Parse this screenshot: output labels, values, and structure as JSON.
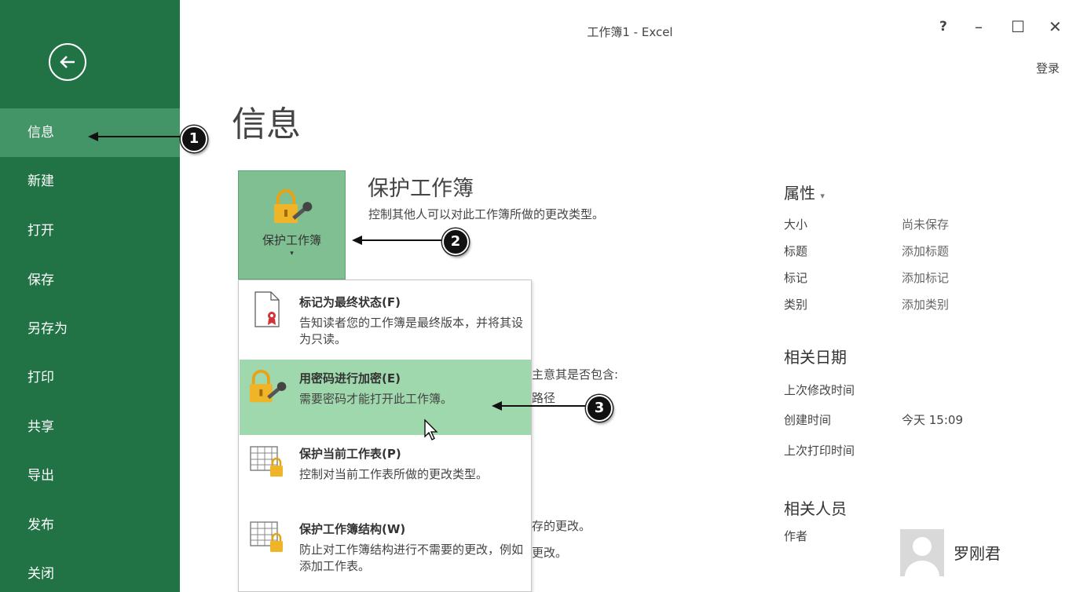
{
  "window": {
    "title": "工作簿1 - Excel",
    "help": "?",
    "minimize": "–",
    "maximize": "☐",
    "close": "✕",
    "login": "登录"
  },
  "sidebar": {
    "back_icon": "back-arrow-circle-icon",
    "items": [
      {
        "label": "信息",
        "active": true
      },
      {
        "label": "新建"
      },
      {
        "label": "打开"
      },
      {
        "label": "保存"
      },
      {
        "label": "另存为"
      },
      {
        "label": "打印"
      },
      {
        "label": "共享"
      },
      {
        "label": "导出"
      },
      {
        "label": "发布"
      },
      {
        "label": "关闭"
      }
    ]
  },
  "main": {
    "title": "信息",
    "protect": {
      "button_label": "保护工作簿",
      "caret": "▾",
      "heading": "保护工作簿",
      "description": "控制其他人可以对此工作簿所做的更改类型。"
    },
    "background_text": {
      "line1": "主意其是否包含:",
      "line2": "路径",
      "line3": "存的更改。",
      "line4": "更改。"
    }
  },
  "dropdown": {
    "items": [
      {
        "title": "标记为最终状态(F)",
        "desc": "告知读者您的工作簿是最终版本，并将其设为只读。",
        "icon": "mark-final-icon"
      },
      {
        "title": "用密码进行加密(E)",
        "desc": "需要密码才能打开此工作簿。",
        "icon": "lock-key-icon",
        "highlighted": true
      },
      {
        "title": "保护当前工作表(P)",
        "desc": "控制对当前工作表所做的更改类型。",
        "icon": "protect-sheet-icon"
      },
      {
        "title": "保护工作簿结构(W)",
        "desc": "防止对工作簿结构进行不需要的更改，例如添加工作表。",
        "icon": "protect-structure-icon"
      }
    ]
  },
  "properties": {
    "heading": "属性",
    "heading_caret": "▾",
    "rows": [
      {
        "label": "大小",
        "value": "尚未保存"
      },
      {
        "label": "标题",
        "value": "添加标题"
      },
      {
        "label": "标记",
        "value": "添加标记"
      },
      {
        "label": "类别",
        "value": "添加类别"
      }
    ],
    "dates_heading": "相关日期",
    "dates": [
      {
        "label": "上次修改时间",
        "value": ""
      },
      {
        "label": "创建时间",
        "value": "今天 15:09"
      },
      {
        "label": "上次打印时间",
        "value": ""
      }
    ],
    "people_heading": "相关人员",
    "author_label": "作者",
    "author_name": "罗刚君"
  },
  "callouts": [
    "1",
    "2",
    "3"
  ]
}
